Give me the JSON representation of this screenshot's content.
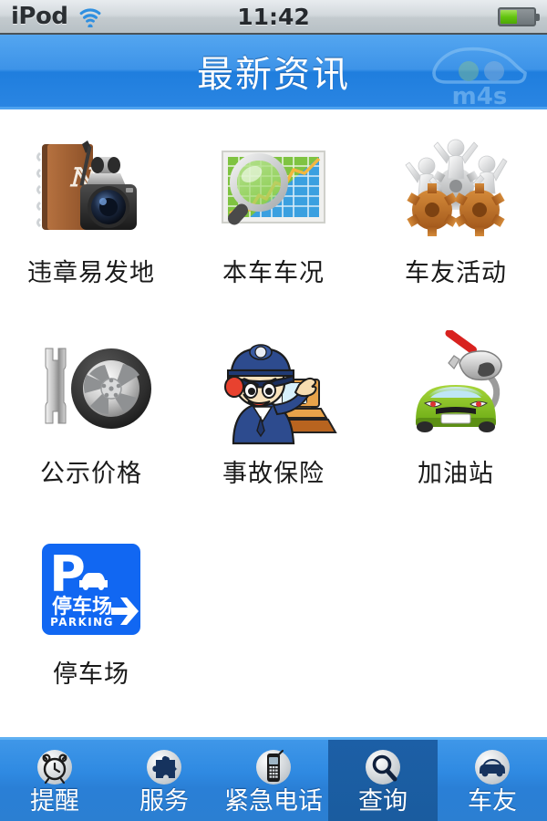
{
  "status_bar": {
    "carrier": "iPod",
    "wifi_icon": "wifi-icon",
    "time": "11:42",
    "battery_icon": "battery-icon",
    "battery_level_percent": 50
  },
  "nav_bar": {
    "title": "最新资讯",
    "logo_text": "m4s",
    "logo_icon": "m4s-cloud-car-logo",
    "background_color": "#2a85e2"
  },
  "grid": {
    "items": [
      {
        "label": "违章易发地",
        "icon": "notebook-camera-icon"
      },
      {
        "label": "本车车况",
        "icon": "chart-magnifier-icon"
      },
      {
        "label": "车友活动",
        "icon": "gears-people-icon"
      },
      {
        "label": "公示价格",
        "icon": "wrench-wheel-icon"
      },
      {
        "label": "事故保险",
        "icon": "police-operator-icon"
      },
      {
        "label": "加油站",
        "icon": "car-fuel-nozzle-icon"
      },
      {
        "label": "停车场",
        "icon": "parking-sign-icon"
      }
    ],
    "parking_sign": {
      "letter": "P",
      "cn_text": "停车场",
      "en_text": "PARKING",
      "arrow": "right-arrow",
      "color": "#1167f2"
    }
  },
  "tab_bar": {
    "selected_index": 3,
    "selected_color": "#1c5fa6",
    "tabs": [
      {
        "label": "提醒",
        "icon": "alarm-clock-icon"
      },
      {
        "label": "服务",
        "icon": "puzzle-piece-icon"
      },
      {
        "label": "紧急电话",
        "icon": "mobile-phone-icon"
      },
      {
        "label": "查询",
        "icon": "magnifier-icon"
      },
      {
        "label": "车友",
        "icon": "car-icon"
      }
    ]
  }
}
